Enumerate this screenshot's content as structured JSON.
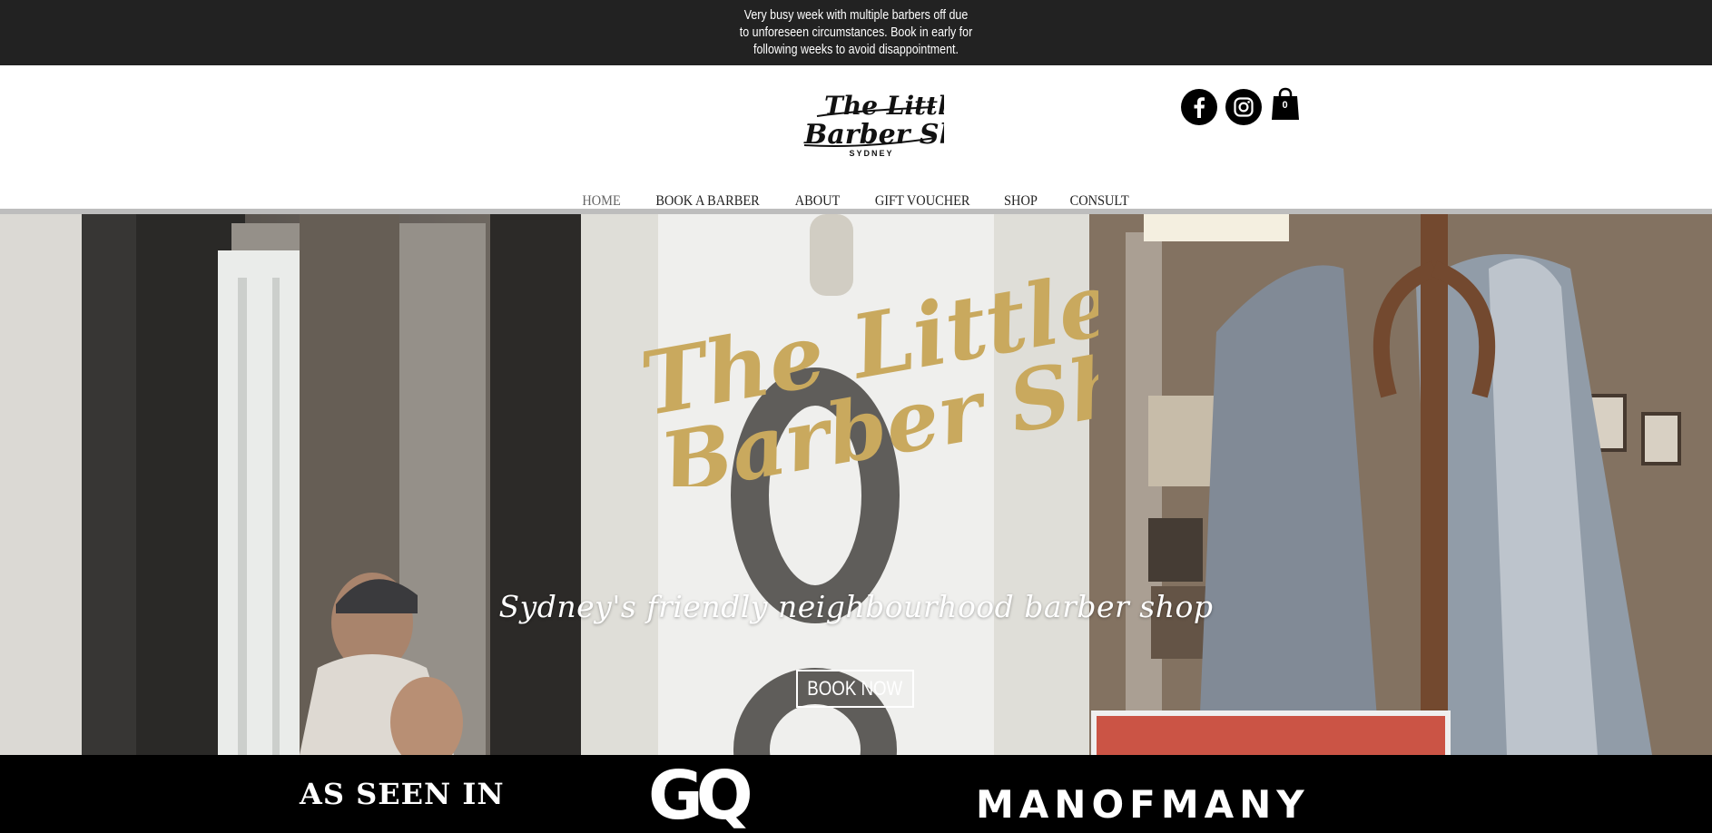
{
  "announcement": {
    "text": "Very busy week with multiple barbers off due to unforeseen circumstances. Book in early for following weeks to avoid disappointment."
  },
  "header": {
    "logo_text": "The Little Barber Shop",
    "logo_subtext": "SYDNEY",
    "social": [
      {
        "name": "facebook",
        "icon": "facebook-icon"
      },
      {
        "name": "instagram",
        "icon": "instagram-icon"
      }
    ],
    "cart": {
      "icon": "shopping-bag-icon",
      "count": "0"
    }
  },
  "nav": {
    "items": [
      {
        "label": "HOME",
        "active": true
      },
      {
        "label": "BOOK A BARBER",
        "active": false
      },
      {
        "label": "ABOUT",
        "active": false
      },
      {
        "label": "GIFT VOUCHER",
        "active": false
      },
      {
        "label": "SHOP",
        "active": false
      },
      {
        "label": "CONSULT",
        "active": false
      }
    ]
  },
  "hero": {
    "logo_text": "The Little Barber Shop",
    "tagline": "Sydney's friendly neighbourhood barber shop",
    "button_label": "BOOK NOW"
  },
  "press": {
    "heading": "AS SEEN IN",
    "logos": [
      "GQ",
      "MANOFMANY"
    ]
  },
  "colors": {
    "announcement_bg": "#222222",
    "gold": "#c9a95e",
    "press_bg": "#000000"
  }
}
